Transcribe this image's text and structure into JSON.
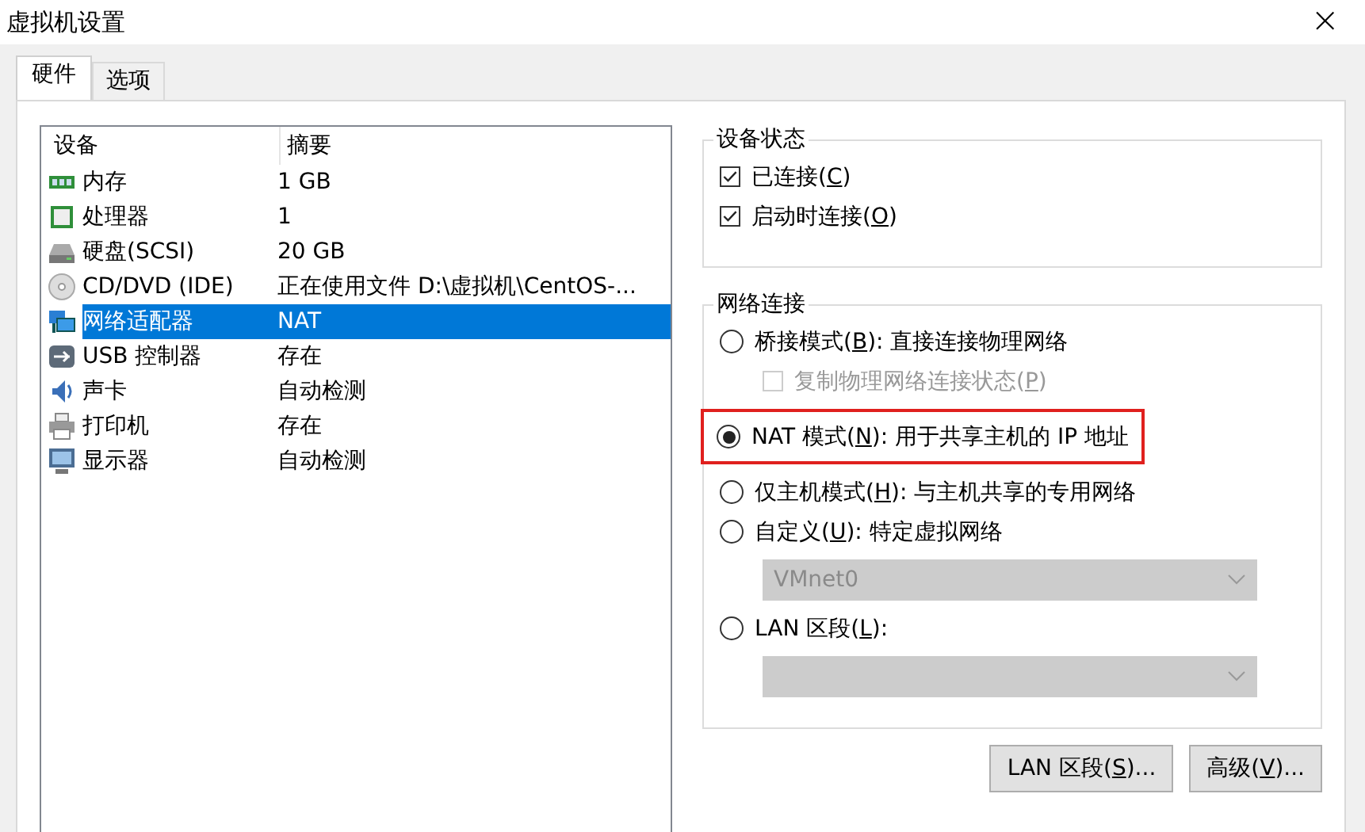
{
  "window": {
    "title": "虚拟机设置",
    "close": "×"
  },
  "tabs": [
    {
      "label": "硬件",
      "selected": true
    },
    {
      "label": "选项",
      "selected": false
    }
  ],
  "devices": {
    "columns": [
      "设备",
      "摘要"
    ],
    "rows": [
      {
        "device": "内存",
        "summary": "1 GB",
        "selected": false
      },
      {
        "device": "处理器",
        "summary": "1",
        "selected": false
      },
      {
        "device": "硬盘(SCSI)",
        "summary": "20 GB",
        "selected": false
      },
      {
        "device": "CD/DVD (IDE)",
        "summary": "正在使用文件 D:\\虚拟机\\CentOS-...",
        "selected": false
      },
      {
        "device": "网络适配器",
        "summary": "NAT",
        "selected": true
      },
      {
        "device": "USB 控制器",
        "summary": "存在",
        "selected": false
      },
      {
        "device": "声卡",
        "summary": "自动检测",
        "selected": false
      },
      {
        "device": "打印机",
        "summary": "存在",
        "selected": false
      },
      {
        "device": "显示器",
        "summary": "自动检测",
        "selected": false
      }
    ]
  },
  "device_status": {
    "title": "设备状态",
    "items": [
      {
        "pre": "已连接(",
        "key": "C",
        "post": ")",
        "checked": true
      },
      {
        "pre": "启动时连接(",
        "key": "O",
        "post": ")",
        "checked": true
      }
    ]
  },
  "network": {
    "title": "网络连接",
    "items": [
      {
        "kind": "radio",
        "pre": "桥接模式(",
        "key": "B",
        "post": "): 直接连接物理网络",
        "selected": false,
        "highlighted": false
      },
      {
        "kind": "checkbox",
        "pre": "复制物理网络连接状态(",
        "key": "P",
        "post": ")",
        "checked": false,
        "disabled": true
      },
      {
        "kind": "radio",
        "pre": "NAT 模式(",
        "key": "N",
        "post": "): 用于共享主机的 IP 地址",
        "selected": true,
        "highlighted": true
      },
      {
        "kind": "radio",
        "pre": "仅主机模式(",
        "key": "H",
        "post": "): 与主机共享的专用网络",
        "selected": false,
        "highlighted": false
      },
      {
        "kind": "radio",
        "pre": "自定义(",
        "key": "U",
        "post": "): 特定虚拟网络",
        "selected": false,
        "highlighted": false
      },
      {
        "kind": "select",
        "value": "VMnet0",
        "disabled": true
      },
      {
        "kind": "radio",
        "pre": "LAN 区段(",
        "key": "L",
        "post": "):",
        "selected": false,
        "highlighted": false
      },
      {
        "kind": "select",
        "disabled": true
      }
    ]
  },
  "buttons": [
    {
      "pre": "LAN 区段(",
      "key": "S",
      "post": ")..."
    },
    {
      "pre": "高级(",
      "key": "V",
      "post": ")..."
    }
  ]
}
